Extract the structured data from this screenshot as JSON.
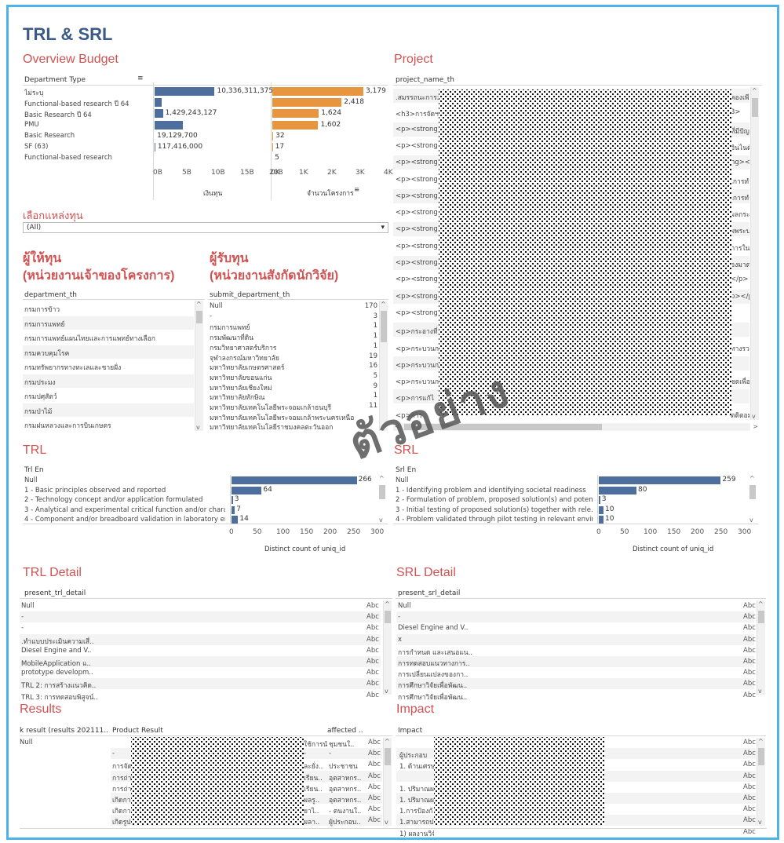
{
  "title": "TRL & SRL",
  "overview": {
    "title": "Overview Budget",
    "col_header": "Department Type",
    "rows": [
      "ไม่ระบุ",
      "Functional-based research ปี 64",
      "Basic Research ปี 64",
      "PMU",
      "Basic Research",
      "SF (63)",
      "Functional-based research"
    ],
    "budget_labels": [
      "10,336,311,375",
      "",
      "1,429,243,127",
      "",
      "19,129,700",
      "117,416,000",
      ""
    ],
    "count_labels": [
      "3,179",
      "2,418",
      "1,624",
      "1,602",
      "32",
      "17",
      "5"
    ],
    "budget_ticks": [
      "0B",
      "5B",
      "10B",
      "15B",
      "20B"
    ],
    "count_ticks": [
      "0K",
      "1K",
      "2K",
      "3K",
      "4K"
    ],
    "budget_axis": "เงินทุน",
    "count_axis": "จำนวนโครงการ"
  },
  "chart_data": [
    {
      "type": "bar",
      "title": "",
      "xlabel": "เงินทุน",
      "categories": [
        "ไม่ระบุ",
        "Functional-based research ปี 64",
        "Basic Research ปี 64",
        "PMU",
        "Basic Research",
        "SF (63)",
        "Functional-based research"
      ],
      "values": [
        10336311375,
        1200000000,
        1429243127,
        4900000000,
        19129700,
        117416000,
        0
      ],
      "xlim": [
        0,
        20000000000
      ]
    },
    {
      "type": "bar",
      "title": "",
      "xlabel": "จำนวนโครงการ",
      "categories": [
        "ไม่ระบุ",
        "Functional-based research ปี 64",
        "Basic Research ปี 64",
        "PMU",
        "Basic Research",
        "SF (63)",
        "Functional-based research"
      ],
      "values": [
        3179,
        2418,
        1624,
        1602,
        32,
        17,
        5
      ],
      "xlim": [
        0,
        4000
      ]
    },
    {
      "type": "bar",
      "title": "",
      "xlabel": "Distinct count of uniq_id",
      "categories": [
        "Null",
        "1 - Basic principles observed and reported",
        "2 - Technology concept and/or application formulated",
        "3 - Analytical and experimental critical function and/or chara..",
        "4 - Component and/or breadboard validation in laboratory env.."
      ],
      "values": [
        266,
        64,
        3,
        7,
        14
      ],
      "xlim": [
        0,
        300
      ]
    },
    {
      "type": "bar",
      "title": "",
      "xlabel": "Distinct count of uniq_id",
      "categories": [
        "Null",
        "1 - Identifying problem and identifying societal readiness",
        "2 - Formulation of problem, proposed solution(s) and poten..",
        "3 - Initial testing of proposed solution(s) together with rele..",
        "4 - Problem validated through pilot testing in relevant environ.."
      ],
      "values": [
        259,
        80,
        3,
        10,
        10
      ],
      "xlim": [
        0,
        300
      ]
    }
  ],
  "filter": {
    "label": "เลือกแหล่งทุน",
    "value": "(All)"
  },
  "funder": {
    "title1": "ผู้ให้ทุน",
    "title2": "(หน่วยงานเจ้าของโครงการ)",
    "col_header": "department_th",
    "rows": [
      "กรมการข้าว",
      "กรมการแพทย์",
      "กรมการแพทย์แผนไทยและการแพทย์ทางเลือก",
      "กรมควบคุมโรค",
      "กรมทรัพยากรทางทะเลและชายฝั่ง",
      "กรมประมง",
      "กรมปศุสัตว์",
      "กรมป่าไม้",
      "กรมฝนหลวงและการบินเกษตร"
    ]
  },
  "recipient": {
    "title1": "ผู้รับทุน",
    "title2": "(หน่วยงานสังกัดนักวิจัย)",
    "col_header": "submit_department_th",
    "rows": [
      "Null",
      "-",
      "กรมการแพทย์",
      "กรมพัฒนาที่ดิน",
      "กรมวิทยาศาสตร์บริการ",
      "จุฬาลงกรณ์มหาวิทยาลัย",
      "มหาวิทยาลัยเกษตรศาสตร์",
      "มหาวิทยาลัยขอนแก่น",
      "มหาวิทยาลัยเชียงใหม่",
      "มหาวิทยาลัยทักษิณ",
      "มหาวิทยาลัยเทคโนโลยีพระจอมเกล้าธนบุรี",
      "มหาวิทยาลัยเทคโนโลยีพระจอมเกล้าพระนครเหนือ",
      "มหาวิทยาลัยเทคโนโลยีราชมงคลตะวันออก"
    ],
    "counts": [
      "170",
      "3",
      "1",
      "1",
      "1",
      "19",
      "16",
      "5",
      "9",
      "1",
      "11",
      "",
      ""
    ]
  },
  "project": {
    "title": "Project",
    "col_header": "project_name_th",
    "rows_left": [
      ".สมรรถนะการ:",
      "<h3>การจัดฯ",
      "<p><strong",
      "<p><strong",
      "<p><strong",
      "<p><strong",
      "<p><strong",
      "<p><strong",
      "<p><strong",
      "<p><strong",
      "<p><strong",
      "<p><strong",
      "<p><strong",
      "<p><strong",
      "<p>กระอางที่",
      "<p>กระบวนก",
      "<p>กระบวนก",
      "<p>กระบวนก",
      "<p>การแก้ไ",
      "<p>การ"
    ],
    "rows_right": [
      "คองเพีย",
      "3>",
      "ที่มีปัญ",
      "อินไนดั",
      "ng><s",
      "เการทำง",
      "เการทำง",
      "ผลกระ",
      "ผพระบา",
      "การใน",
      "องมาตรฐ",
      "</p>",
      "p></p>",
      "",
      "",
      "ทางรว",
      "",
      "ชดเพื่อไ",
      "",
      "ตดิตอม"
    ]
  },
  "trl": {
    "title": "TRL",
    "col_header": "Trl En",
    "rows": [
      "Null",
      "1 - Basic principles observed and reported",
      "2 - Technology concept and/or application formulated",
      "3 - Analytical and experimental critical function and/or chara..",
      "4 - Component and/or breadboard validation in laboratory env.."
    ],
    "labels": [
      "266",
      "64",
      "3",
      "7",
      "14"
    ],
    "ticks": [
      "0",
      "50",
      "100",
      "150",
      "200",
      "250",
      "300"
    ],
    "axis": "Distinct count of uniq_id"
  },
  "srl": {
    "title": "SRL",
    "col_header": "Srl En",
    "rows": [
      "Null",
      "1 - Identifying problem and identifying societal readiness",
      "2 - Formulation of problem, proposed solution(s) and poten..",
      "3 - Initial testing of proposed solution(s) together with rele..",
      "4 - Problem validated through pilot testing in relevant environ.."
    ],
    "labels": [
      "259",
      "80",
      "3",
      "10",
      "10"
    ],
    "ticks": [
      "0",
      "50",
      "100",
      "150",
      "200",
      "250",
      "300"
    ],
    "axis": "Distinct count of uniq_id"
  },
  "trl_detail": {
    "title": "TRL Detail",
    "col_header": "present_trl_detail",
    "rows": [
      "Null",
      "-",
      "-",
      ".ทำแบบประเมินความเสี่..",
      "Diesel Engine and V..",
      "MobileApplication แ..",
      "prototype developm..",
      "TRL 2: การสร้างแนวคิด..",
      "TRL 3: การทดสอบพิสูจน์.."
    ],
    "abc": "Abc"
  },
  "srl_detail": {
    "title": "SRL Detail",
    "col_header": "present_srl_detail",
    "rows": [
      "Null",
      "-",
      "Diesel Engine and V..",
      "x",
      "การกำหนด และเสนอแน..",
      "การทดสอบแนวทางการ..",
      "การเปลี่ยนแปลงของกา..",
      "การศึกษาวิจัยเพื่อพัฒน..",
      "การศึกษาวิจัยเพื่อพัฒน.."
    ],
    "abc": "Abc"
  },
  "results": {
    "title": "Results",
    "col1": "k result (results 202111..",
    "col2": "Product Result",
    "col3": "affected ..",
    "first": "Null",
    "col2_rows": [
      "",
      "-",
      "การจัด",
      "การถ่า",
      "การถ่า",
      "เกิดกา",
      "เกิดกา",
      "เกิดรูป"
    ],
    "col2b_rows": [
      "ใช้การนำเสนอ",
      "-",
      "ละยั่ง..",
      "เรียน..",
      "เรียน..",
      "ผลรู..",
      "ยาไ..",
      "ผลา.."
    ],
    "col3_rows": [
      "ชุมชนใ..",
      "-",
      "ประชาชน",
      "อุตสาหกร..",
      "อุตสาหกร..",
      "อุตสาหกร..",
      "- ตนงานใ..",
      "ผู้ประกอบ.."
    ],
    "abc": "Abc"
  },
  "impact": {
    "title": "Impact",
    "col_header": "Impact",
    "rows": [
      "",
      "ผู้ประกอบ",
      "1. ด้านเศรษ",
      "",
      "1. ปริมาณผ",
      "1. ปริมาณผ",
      "1.การป้องกั",
      "1.สามารถป",
      "1) ผลงานวิจั"
    ],
    "abc": "Abc"
  }
}
